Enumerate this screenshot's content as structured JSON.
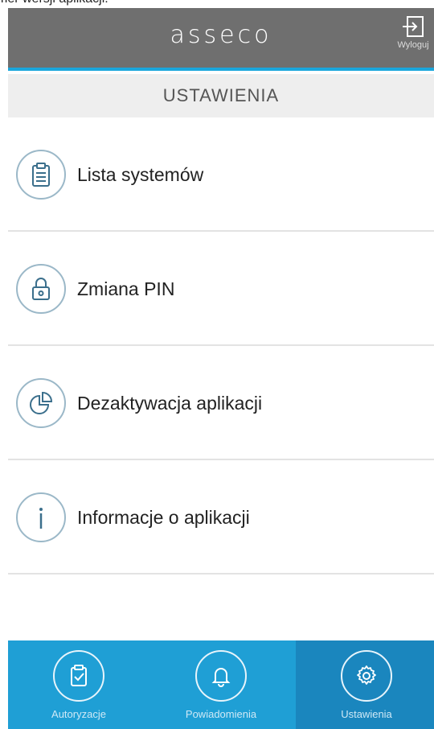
{
  "caption": "mer wersji aplikacji.",
  "header": {
    "logo": "asseco",
    "logout_label": "Wyloguj"
  },
  "page_title": "USTAWIENIA",
  "menu": [
    {
      "label": "Lista systemów",
      "icon": "clipboard-icon"
    },
    {
      "label": "Zmiana PIN",
      "icon": "lock-icon"
    },
    {
      "label": "Dezaktywacja aplikacji",
      "icon": "pie-chart-icon"
    },
    {
      "label": "Informacje o aplikacji",
      "icon": "info-icon"
    }
  ],
  "bottom_nav": [
    {
      "label": "Autoryzacje",
      "icon": "clipboard-check-icon",
      "active": false
    },
    {
      "label": "Powiadomienia",
      "icon": "bell-icon",
      "active": false
    },
    {
      "label": "Ustawienia",
      "icon": "gear-icon",
      "active": true
    }
  ],
  "colors": {
    "header_bg": "#6f6f6f",
    "accent": "#1aa6dc",
    "nav_bg": "#1f9fd5",
    "nav_active_bg": "#1a86be",
    "icon_stroke": "#3b6f8c"
  }
}
